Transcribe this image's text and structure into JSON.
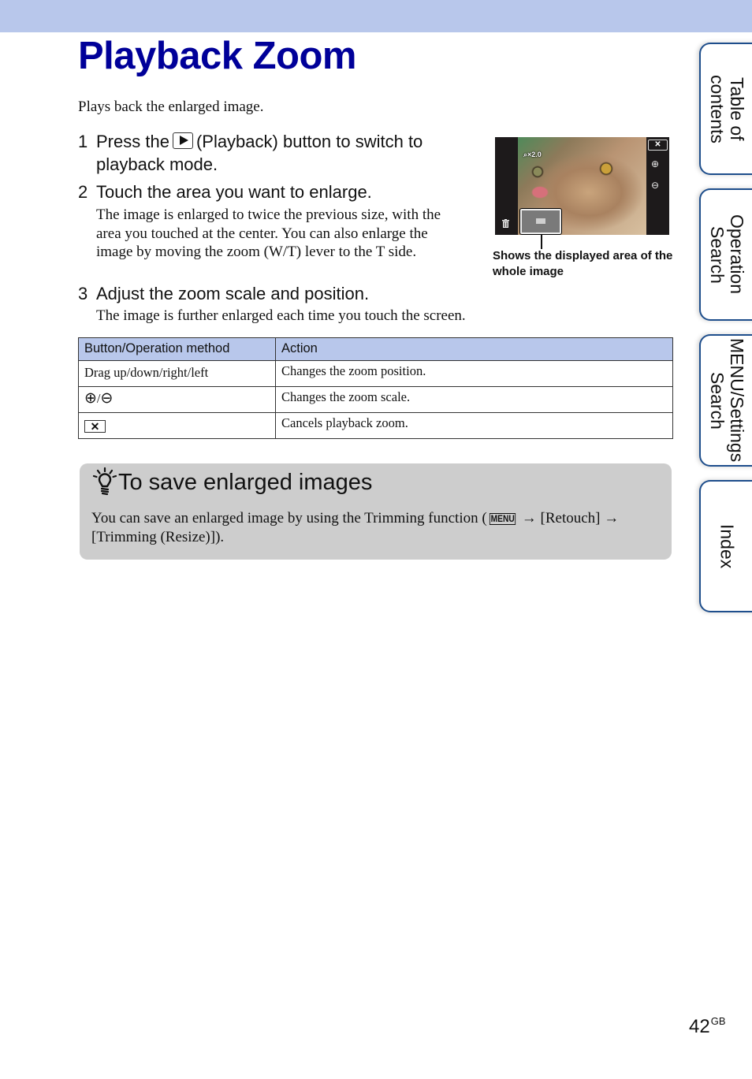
{
  "page": {
    "title": "Playback Zoom",
    "intro": "Plays back the enlarged image.",
    "page_number": "42",
    "page_suffix": "GB"
  },
  "steps": [
    {
      "num": "1",
      "text_before": "Press the",
      "icon": "playback-button-icon",
      "text_after": "(Playback) button to switch to",
      "text_line2": "playback mode."
    },
    {
      "num": "2",
      "text": "Touch the area you want to enlarge.",
      "description": "The image is enlarged to twice the previous size, with the area you touched at the center. You can also enlarge the image by moving the zoom (W/T) lever to the T side."
    },
    {
      "num": "3",
      "text": "Adjust the zoom scale and position.",
      "description": "The image is further enlarged each time you touch the screen."
    }
  ],
  "illustration": {
    "zoom_badge": "⌕×2.0",
    "close_label": "✕",
    "zoom_in_icon": "⊕",
    "zoom_out_icon": "⊖",
    "trash_icon": "␡",
    "caption": "Shows the displayed area of the whole image"
  },
  "table": {
    "headers": [
      "Button/Operation method",
      "Action"
    ],
    "rows": [
      {
        "method": "Drag up/down/right/left",
        "action": "Changes the zoom position."
      },
      {
        "method_icons": [
          "zoom-in-icon",
          "zoom-out-icon"
        ],
        "separator": "/",
        "zoom_in": "⊕",
        "zoom_out": "⊖",
        "action": "Changes the zoom scale."
      },
      {
        "method_icon": "close-icon",
        "close": "✕",
        "action": "Cancels playback zoom."
      }
    ]
  },
  "tip": {
    "title": "To save enlarged images",
    "body_before": "You can save an enlarged image by using the Trimming function (",
    "menu_key": "MENU",
    "arrow": "→",
    "retouch": "[Retouch]",
    "body_after": "[Trimming (Resize)])."
  },
  "side_tabs": [
    {
      "label": "Table of\ncontents"
    },
    {
      "label": "Operation\nSearch"
    },
    {
      "label": "MENU/Settings\nSearch"
    },
    {
      "label": "Index"
    }
  ],
  "colors": {
    "header_band": "#b8c7eb",
    "title": "#000099",
    "tab_border": "#1e4e8c",
    "tip_background": "#cdcdcd"
  }
}
